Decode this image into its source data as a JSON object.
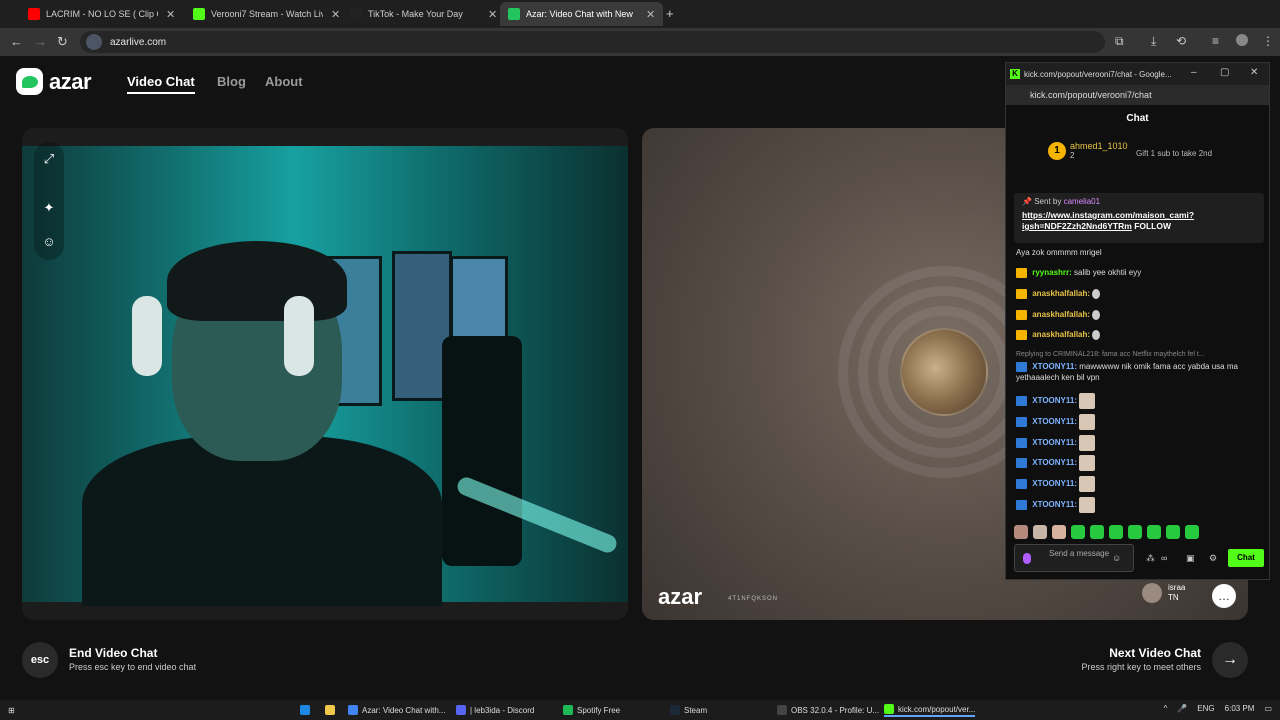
{
  "browser": {
    "tabs": [
      {
        "title": "LACRIM - NO LO SE ( Clip Offici",
        "color": "#ff0000"
      },
      {
        "title": "Verooni7 Stream - Watch Live o",
        "color": "#53fc18"
      },
      {
        "title": "TikTok - Make Your Day",
        "color": "#222222"
      },
      {
        "title": "Azar: Video Chat with New",
        "color": "#22c55e"
      }
    ],
    "url": "azarlive.com"
  },
  "azar": {
    "logo": "azar",
    "nav": [
      "Video Chat",
      "Blog",
      "About"
    ],
    "watermark": "azar",
    "peer_id": "4T1NFQKSON",
    "peer": {
      "name": "israa",
      "country": "TN"
    },
    "end": {
      "key": "esc",
      "title": "End Video Chat",
      "subtitle": "Press esc key to end video chat"
    },
    "next": {
      "title": "Next Video Chat",
      "subtitle": "Press right key to meet others"
    }
  },
  "popup": {
    "title": "kick.com/popout/verooni7/chat - Google...",
    "url": "kick.com/popout/verooni7/chat",
    "header": "Chat",
    "gifter": {
      "rank": "1",
      "name": "ahmed1_1010",
      "count": "2",
      "gift_text": "Gift 1 sub to take 2nd"
    },
    "pinned": {
      "sent_by": "Sent by",
      "user": "camelia01",
      "link": "https://www.instagram.com/maison_cami?igsh=NDF2Zzh2Nnd6YTRm",
      "suffix": "FOLLOW"
    },
    "messages": [
      {
        "user": "",
        "text": "Aya zok ommmm mrigel",
        "color": "#ddd"
      },
      {
        "user": "ryynashrr:",
        "text": "salib yee okhtii eyy",
        "color": "#53fc18"
      },
      {
        "user": "anaskhalfallah:",
        "text": "",
        "color": "#e8c34a"
      },
      {
        "user": "anaskhalfallah:",
        "text": "",
        "color": "#e8c34a"
      },
      {
        "user": "anaskhalfallah:",
        "text": "",
        "color": "#e8c34a"
      },
      {
        "user": "XTOONY11:",
        "text": "mawwwww nik omik fama acc yabda usa ma yethaaalech ken bil vpn",
        "color": "#7fb4ff",
        "reply": "Replying to CRIMINAL218: fama acc Netflix maythelch fel t..."
      },
      {
        "user": "XTOONY11:",
        "text": "",
        "color": "#7fb4ff"
      },
      {
        "user": "XTOONY11:",
        "text": "",
        "color": "#7fb4ff"
      },
      {
        "user": "XTOONY11:",
        "text": "",
        "color": "#7fb4ff"
      },
      {
        "user": "XTOONY11:",
        "text": "",
        "color": "#7fb4ff"
      },
      {
        "user": "XTOONY11:",
        "text": "",
        "color": "#7fb4ff"
      },
      {
        "user": "XTOONY11:",
        "text": "",
        "color": "#7fb4ff"
      }
    ],
    "input_placeholder": "Send a message",
    "send_label": "Chat"
  },
  "taskbar": {
    "items": [
      "Azar: Video Chat with...",
      "| leb3ida - Discord",
      "Spotify Free",
      "Steam",
      "OBS 32.0.4 - Profile: U...",
      "kick.com/popout/ver..."
    ],
    "lang": "ENG",
    "time": "6:03 PM"
  }
}
